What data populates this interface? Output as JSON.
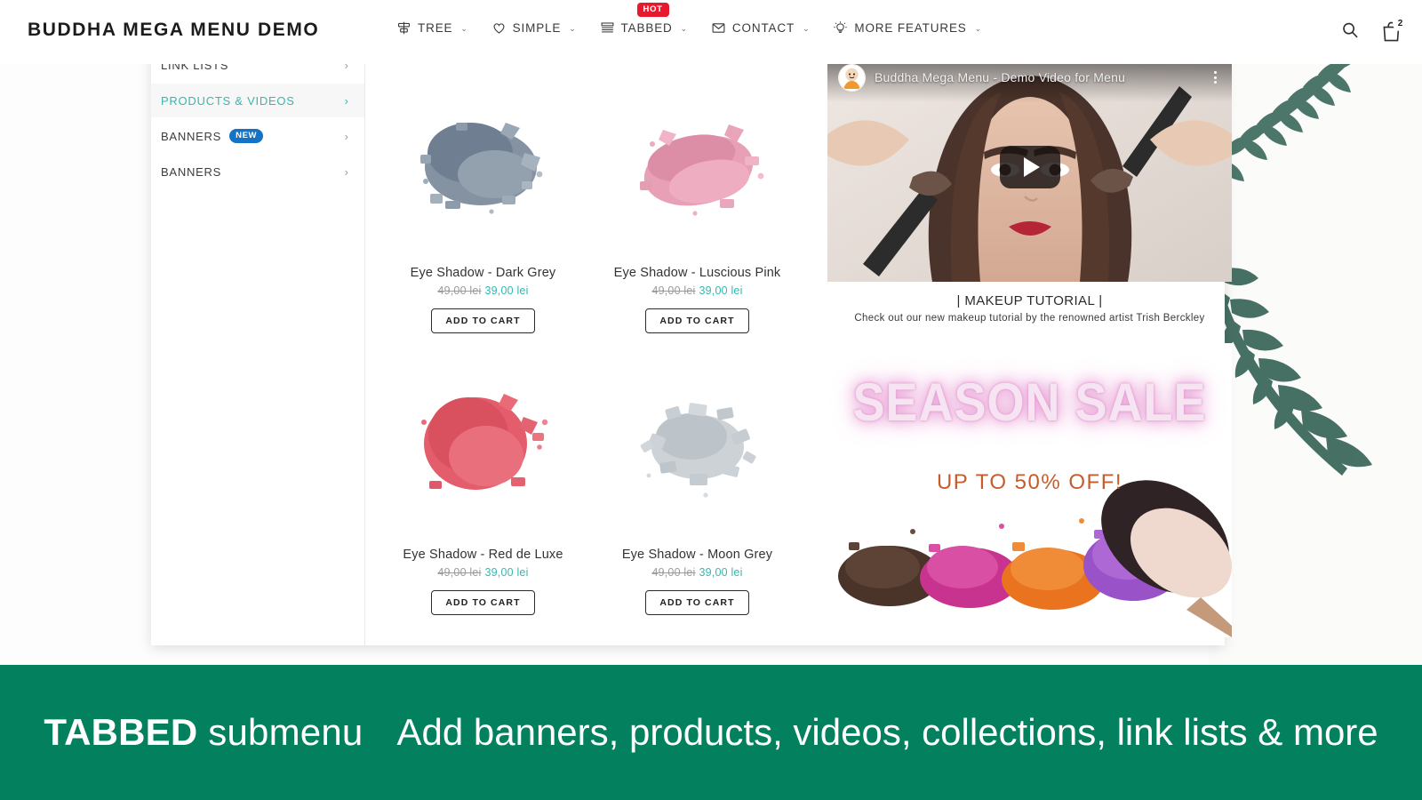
{
  "colors": {
    "accent_teal": "#35b8b1",
    "promo_green": "#03805E",
    "badge_hot_red": "#e8192c",
    "badge_new_blue": "#1473c4",
    "sale_orange": "#c45c2e",
    "sale_pink": "#e79ad3"
  },
  "header": {
    "brand": "BUDDHA MEGA MENU DEMO",
    "nav": [
      {
        "label": "TREE",
        "icon": "signpost-icon",
        "caret": "⌄",
        "badge": null
      },
      {
        "label": "SIMPLE",
        "icon": "heart-icon",
        "caret": "⌄",
        "badge": null
      },
      {
        "label": "TABBED",
        "icon": "list-stack-icon",
        "caret": "⌄",
        "badge": "HOT"
      },
      {
        "label": "CONTACT",
        "icon": "envelope-icon",
        "caret": "⌄",
        "badge": null
      },
      {
        "label": "MORE FEATURES",
        "icon": "lightbulb-icon",
        "caret": "⌄",
        "badge": null
      }
    ],
    "actions": {
      "search_icon": "search-icon",
      "cart_icon": "shopping-bag-icon",
      "cart_count": "2"
    }
  },
  "megamenu": {
    "tabs": [
      {
        "label": "LINK LISTS",
        "badge": null,
        "active": false,
        "chevron": "›"
      },
      {
        "label": "PRODUCTS & VIDEOS",
        "badge": null,
        "active": true,
        "chevron": "›"
      },
      {
        "label": "BANNERS",
        "badge": "NEW",
        "active": false,
        "chevron": "›"
      },
      {
        "label": "BANNERS",
        "badge": null,
        "active": false,
        "chevron": "›"
      }
    ],
    "products": [
      {
        "title": "Eye Shadow - Dark Grey",
        "price_old": "49,00 lei",
        "price_new": "39,00 lei",
        "button": "ADD TO CART",
        "swatch_color": "#7e8c9c",
        "swatch_kind": "crushed-powder"
      },
      {
        "title": "Eye Shadow - Luscious Pink",
        "price_old": "49,00 lei",
        "price_new": "39,00 lei",
        "button": "ADD TO CART",
        "swatch_color": "#e294ac",
        "swatch_kind": "crushed-powder"
      },
      {
        "title": "Eye Shadow - Red de Luxe",
        "price_old": "49,00 lei",
        "price_new": "39,00 lei",
        "button": "ADD TO CART",
        "swatch_color": "#e05562",
        "swatch_kind": "crushed-powder"
      },
      {
        "title": "Eye Shadow - Moon Grey",
        "price_old": "49,00 lei",
        "price_new": "39,00 lei",
        "button": "ADD TO CART",
        "swatch_color": "#c0c6cb",
        "swatch_kind": "crushed-powder"
      }
    ],
    "video": {
      "channel_icon": "buddha-avatar-icon",
      "title": "Buddha Mega Menu - Demo Video for Menu",
      "menu_icon": "kebab-menu-icon",
      "play_icon": "play-icon",
      "caption_title": "| MAKEUP TUTORIAL |",
      "caption_sub": "Check out our new makeup tutorial by the renowned artist Trish Berckley"
    },
    "banner": {
      "title": "SEASON SALE",
      "subtitle": "UP TO 50% OFF!"
    }
  },
  "promo": {
    "strong": "TABBED",
    "strong_tail": " submenu",
    "text": "Add banners, products, videos, collections, link lists & more"
  }
}
